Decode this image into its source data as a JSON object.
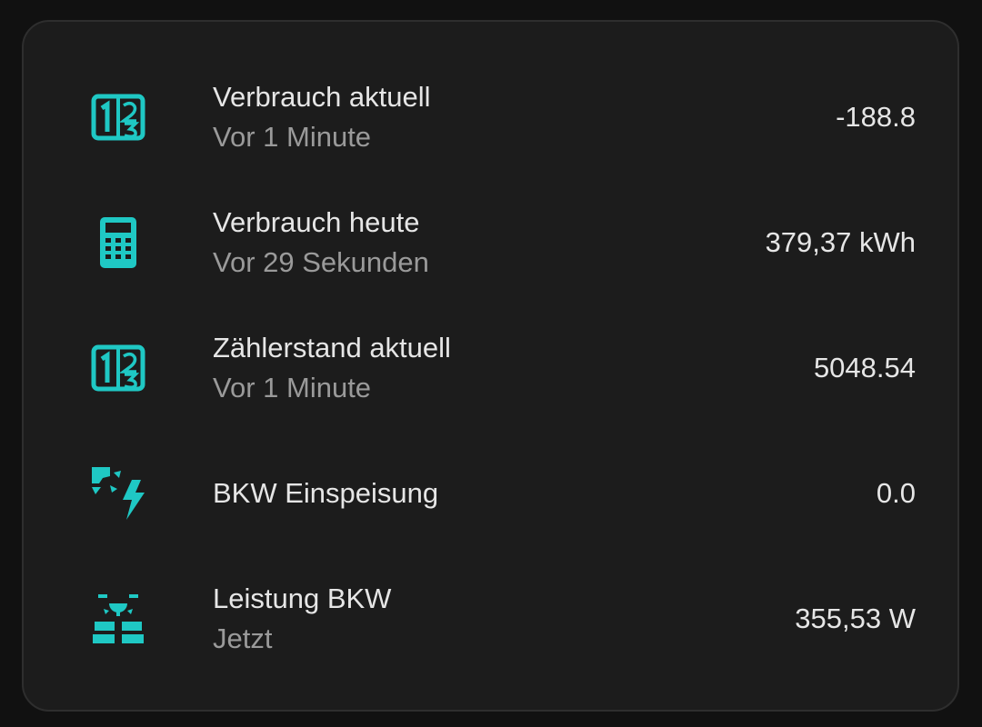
{
  "accent_color": "#1fc8c4",
  "rows": [
    {
      "icon": "counter-icon",
      "name": "Verbrauch aktuell",
      "sub": "Vor 1 Minute",
      "value": "-188.8"
    },
    {
      "icon": "calculator-icon",
      "name": "Verbrauch heute",
      "sub": "Vor 29 Sekunden",
      "value": "379,37 kWh"
    },
    {
      "icon": "counter-icon",
      "name": "Zählerstand aktuell",
      "sub": "Vor 1 Minute",
      "value": "5048.54"
    },
    {
      "icon": "solar-power-icon",
      "name": "BKW Einspeisung",
      "sub": "",
      "value": "0.0"
    },
    {
      "icon": "solar-panel-icon",
      "name": "Leistung BKW",
      "sub": "Jetzt",
      "value": "355,53 W"
    }
  ]
}
